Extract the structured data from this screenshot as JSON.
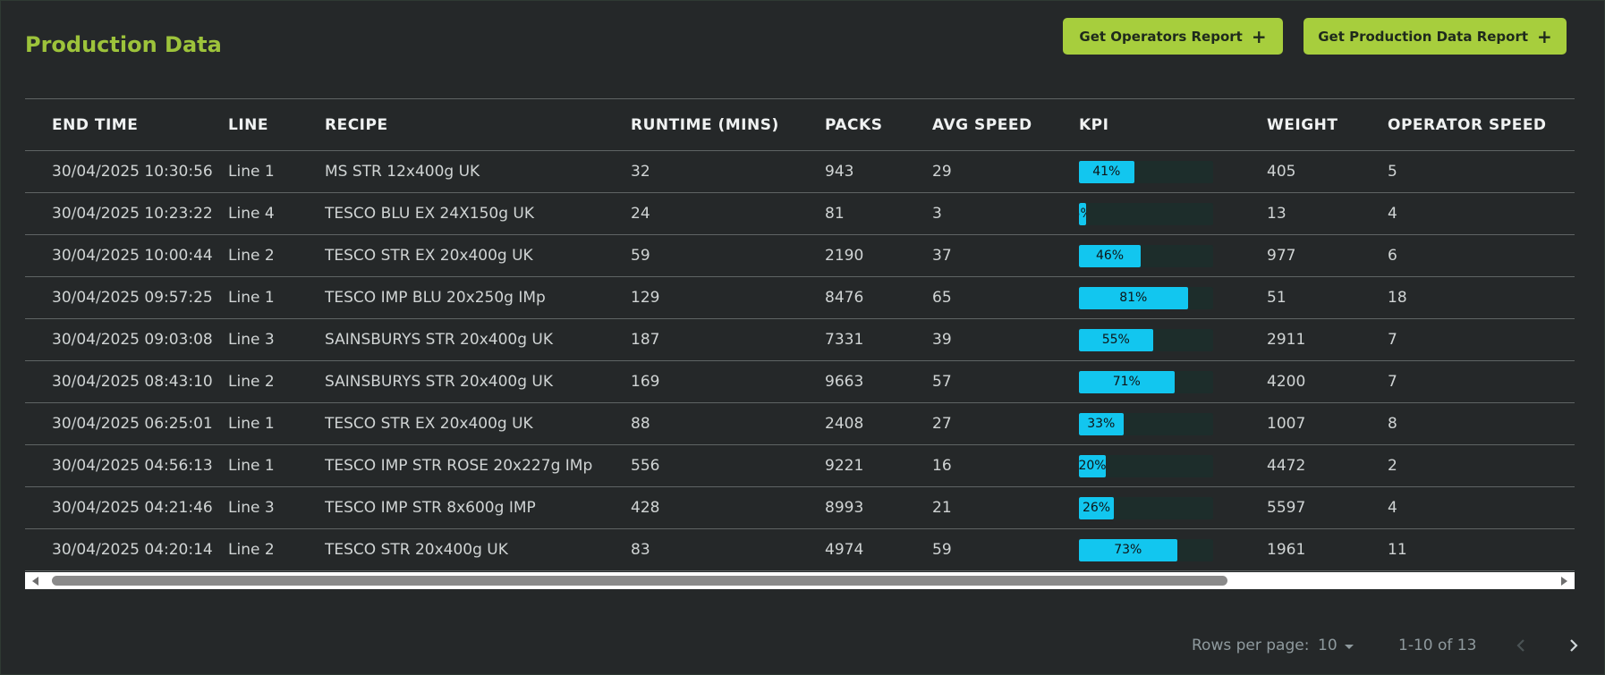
{
  "page": {
    "title": "Production Data"
  },
  "toolbar": {
    "operators_report_label": "Get Operators Report",
    "production_report_label": "Get Production Data Report",
    "plus_glyph": "+"
  },
  "table": {
    "columns": [
      "END TIME",
      "LINE",
      "RECIPE",
      "RUNTIME (MINS)",
      "PACKS",
      "AVG SPEED",
      "KPI",
      "WEIGHT",
      "OPERATOR SPEED"
    ],
    "rows": [
      {
        "end_time": "30/04/2025 10:30:56",
        "line": "Line 1",
        "recipe": "MS STR 12x400g UK",
        "runtime": "32",
        "packs": "943",
        "avg_speed": "29",
        "kpi": 41,
        "kpi_label": "41%",
        "weight": "405",
        "operator_speed": "5"
      },
      {
        "end_time": "30/04/2025 10:23:22",
        "line": "Line 4",
        "recipe": "TESCO BLU EX 24X150g UK",
        "runtime": "24",
        "packs": "81",
        "avg_speed": "3",
        "kpi": 5,
        "kpi_label": "5%",
        "weight": "13",
        "operator_speed": "4"
      },
      {
        "end_time": "30/04/2025 10:00:44",
        "line": "Line 2",
        "recipe": "TESCO STR EX 20x400g UK",
        "runtime": "59",
        "packs": "2190",
        "avg_speed": "37",
        "kpi": 46,
        "kpi_label": "46%",
        "weight": "977",
        "operator_speed": "6"
      },
      {
        "end_time": "30/04/2025 09:57:25",
        "line": "Line 1",
        "recipe": "TESCO IMP BLU 20x250g IMp",
        "runtime": "129",
        "packs": "8476",
        "avg_speed": "65",
        "kpi": 81,
        "kpi_label": "81%",
        "weight": "51",
        "operator_speed": "18"
      },
      {
        "end_time": "30/04/2025 09:03:08",
        "line": "Line 3",
        "recipe": "SAINSBURYS STR 20x400g UK",
        "runtime": "187",
        "packs": "7331",
        "avg_speed": "39",
        "kpi": 55,
        "kpi_label": "55%",
        "weight": "2911",
        "operator_speed": "7"
      },
      {
        "end_time": "30/04/2025 08:43:10",
        "line": "Line 2",
        "recipe": "SAINSBURYS STR 20x400g UK",
        "runtime": "169",
        "packs": "9663",
        "avg_speed": "57",
        "kpi": 71,
        "kpi_label": "71%",
        "weight": "4200",
        "operator_speed": "7"
      },
      {
        "end_time": "30/04/2025 06:25:01",
        "line": "Line 1",
        "recipe": "TESCO STR EX 20x400g UK",
        "runtime": "88",
        "packs": "2408",
        "avg_speed": "27",
        "kpi": 33,
        "kpi_label": "33%",
        "weight": "1007",
        "operator_speed": "8"
      },
      {
        "end_time": "30/04/2025 04:56:13",
        "line": "Line 1",
        "recipe": "TESCO IMP STR ROSE 20x227g IMp",
        "runtime": "556",
        "packs": "9221",
        "avg_speed": "16",
        "kpi": 20,
        "kpi_label": "20%",
        "weight": "4472",
        "operator_speed": "2"
      },
      {
        "end_time": "30/04/2025 04:21:46",
        "line": "Line 3",
        "recipe": "TESCO IMP STR 8x600g IMP",
        "runtime": "428",
        "packs": "8993",
        "avg_speed": "21",
        "kpi": 26,
        "kpi_label": "26%",
        "weight": "5597",
        "operator_speed": "4"
      },
      {
        "end_time": "30/04/2025 04:20:14",
        "line": "Line 2",
        "recipe": "TESCO STR 20x400g UK",
        "runtime": "83",
        "packs": "4974",
        "avg_speed": "59",
        "kpi": 73,
        "kpi_label": "73%",
        "weight": "1961",
        "operator_speed": "11"
      }
    ]
  },
  "pagination": {
    "rows_per_page_label": "Rows per page:",
    "rows_per_page_value": "10",
    "range_text": "1-10 of 13"
  },
  "colors": {
    "background": "#252829",
    "accent_green": "#a7ce3d",
    "title_green": "#9dc33b",
    "kpi_fill": "#12c6ef",
    "kpi_track": "#1d2d2b"
  },
  "icons": {
    "plus": "plus-icon",
    "prev": "chevron-left-icon",
    "next": "chevron-right-icon",
    "dropdown": "caret-down-icon"
  }
}
